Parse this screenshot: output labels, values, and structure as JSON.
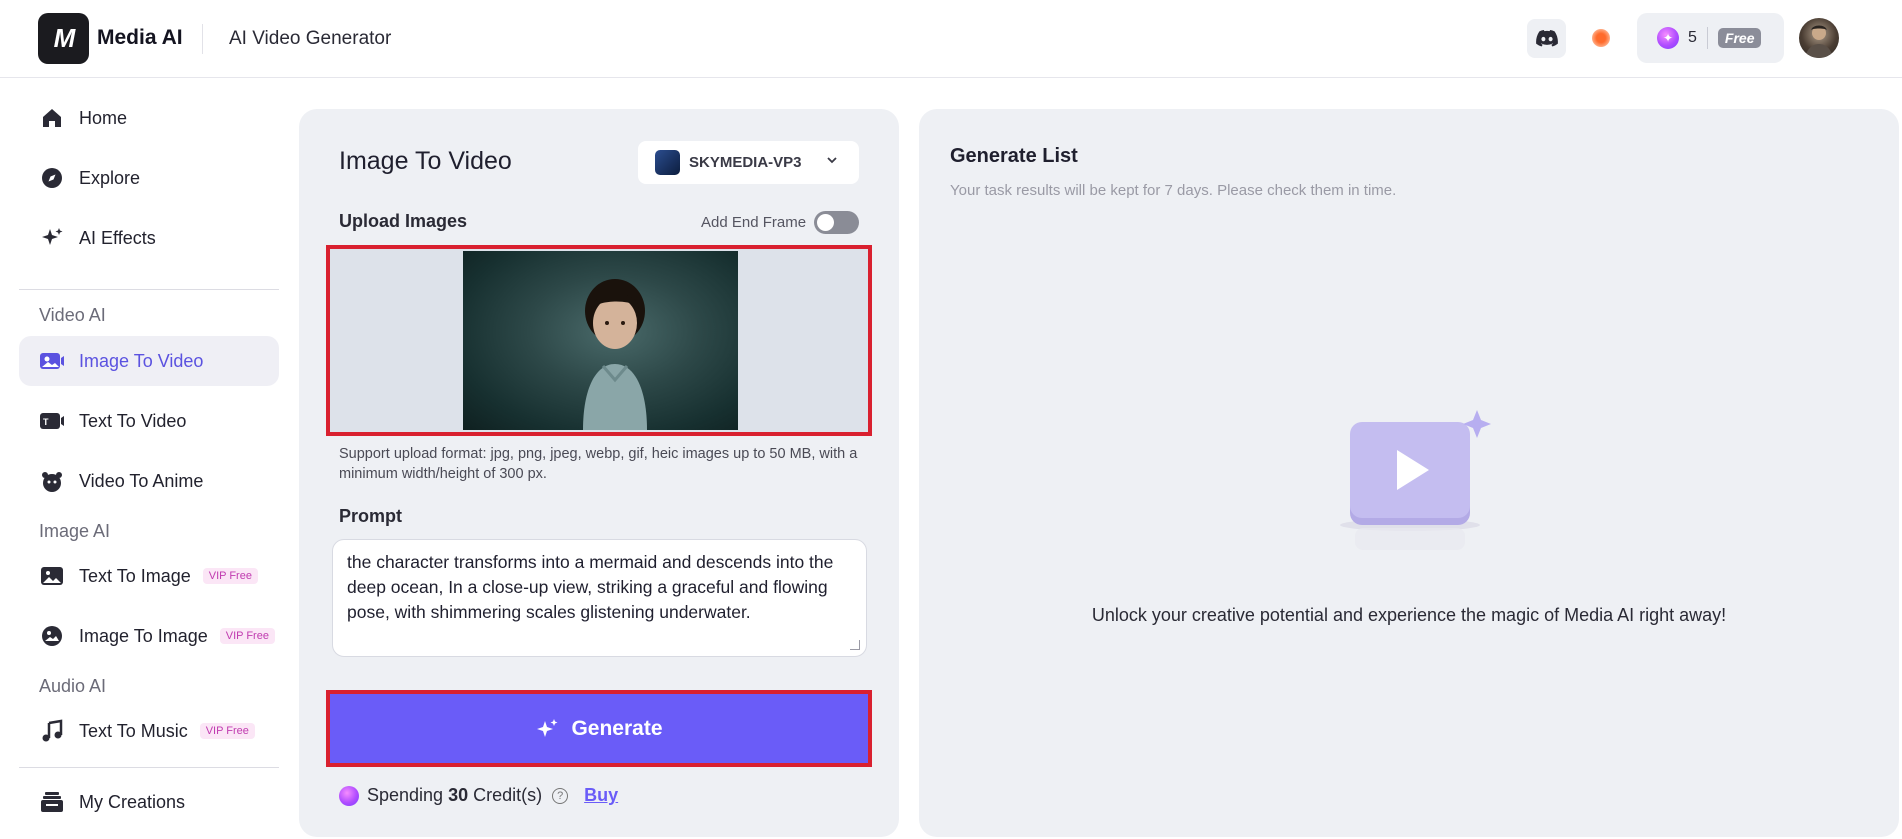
{
  "header": {
    "logo_text": "M",
    "app_name": "Media AI",
    "page_title": "AI Video Generator",
    "credits": "5",
    "plan_badge": "Free"
  },
  "sidebar": {
    "top_items": [
      {
        "label": "Home",
        "icon": "home-icon"
      },
      {
        "label": "Explore",
        "icon": "compass-icon"
      },
      {
        "label": "AI Effects",
        "icon": "sparkle-icon"
      }
    ],
    "sections": {
      "video": "Video AI",
      "image": "Image AI",
      "audio": "Audio AI"
    },
    "video_items": [
      {
        "label": "Image To Video",
        "icon": "image-video-icon",
        "active": true
      },
      {
        "label": "Text To Video",
        "icon": "text-video-icon"
      },
      {
        "label": "Video To Anime",
        "icon": "anime-icon"
      }
    ],
    "image_items": [
      {
        "label": "Text To Image",
        "badge": "VIP Free",
        "icon": "text-image-icon"
      },
      {
        "label": "Image To Image",
        "badge": "VIP Free",
        "icon": "image-image-icon"
      }
    ],
    "audio_items": [
      {
        "label": "Text To Music",
        "badge": "VIP Free",
        "icon": "music-icon"
      }
    ],
    "bottom_items": [
      {
        "label": "My Creations",
        "icon": "creations-icon"
      }
    ]
  },
  "editor": {
    "title": "Image To Video",
    "model": "SKYMEDIA-VP3",
    "upload_label": "Upload Images",
    "end_frame_label": "Add End Frame",
    "end_frame_enabled": false,
    "upload_hint": "Support upload format: jpg, png, jpeg, webp, gif, heic images up to 50 MB, with a minimum width/height of 300 px.",
    "prompt_label": "Prompt",
    "prompt_value": "the character transforms into a mermaid and descends into the deep ocean, In a close-up view, striking a graceful and flowing pose, with shimmering scales glistening underwater.",
    "generate_label": "Generate",
    "spending_prefix": "Spending",
    "spending_amount": "30",
    "spending_suffix": "Credit(s)",
    "buy_label": "Buy"
  },
  "results": {
    "title": "Generate List",
    "subtitle": "Your task results will be kept for 7 days. Please check them in time.",
    "empty_message": "Unlock your creative potential and experience the magic of Media AI right away!"
  },
  "colors": {
    "accent": "#6a5cf8",
    "highlight_border": "#d9202f",
    "panel_bg": "#eef0f4",
    "active_nav_text": "#5b52e0"
  }
}
